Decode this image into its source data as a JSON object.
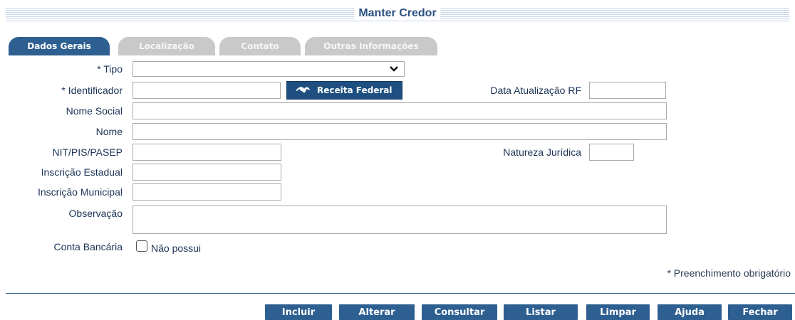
{
  "page": {
    "title": "Manter Credor"
  },
  "tabs": [
    {
      "label": "Dados Gerais",
      "active": true
    },
    {
      "label": "Localização",
      "active": false
    },
    {
      "label": "Contato",
      "active": false
    },
    {
      "label": "Outras Informações",
      "active": false
    }
  ],
  "form": {
    "tipo": {
      "label": "* Tipo",
      "value": ""
    },
    "identificador": {
      "label": "* Identificador",
      "value": ""
    },
    "receita_button": "Receita Federal",
    "data_atualizacao": {
      "label": "Data Atualização RF",
      "value": ""
    },
    "nome_social": {
      "label": "Nome Social",
      "value": ""
    },
    "nome": {
      "label": "Nome",
      "value": ""
    },
    "nit": {
      "label": "NIT/PIS/PASEP",
      "value": ""
    },
    "natureza": {
      "label": "Natureza Jurídica",
      "value": ""
    },
    "inscricao_estadual": {
      "label": "Inscrição Estadual",
      "value": ""
    },
    "inscricao_municipal": {
      "label": "Inscrição Municipal",
      "value": ""
    },
    "observacao": {
      "label": "Observação",
      "value": ""
    },
    "conta_bancaria": {
      "label": "Conta Bancária",
      "checkbox_label": "Não possui",
      "checked": false
    }
  },
  "footer": {
    "required_note": "* Preenchimento obrigatório",
    "buttons": [
      "Incluir",
      "Alterar",
      "Consultar",
      "Listar",
      "Limpar",
      "Ajuda",
      "Fechar"
    ]
  },
  "colors": {
    "primary": "#2e5f91",
    "inactive_tab": "#c9c9c9",
    "label": "#1a3355"
  },
  "icons": {
    "receita": "receita-federal-logo-icon",
    "select": "chevron-down-icon"
  }
}
